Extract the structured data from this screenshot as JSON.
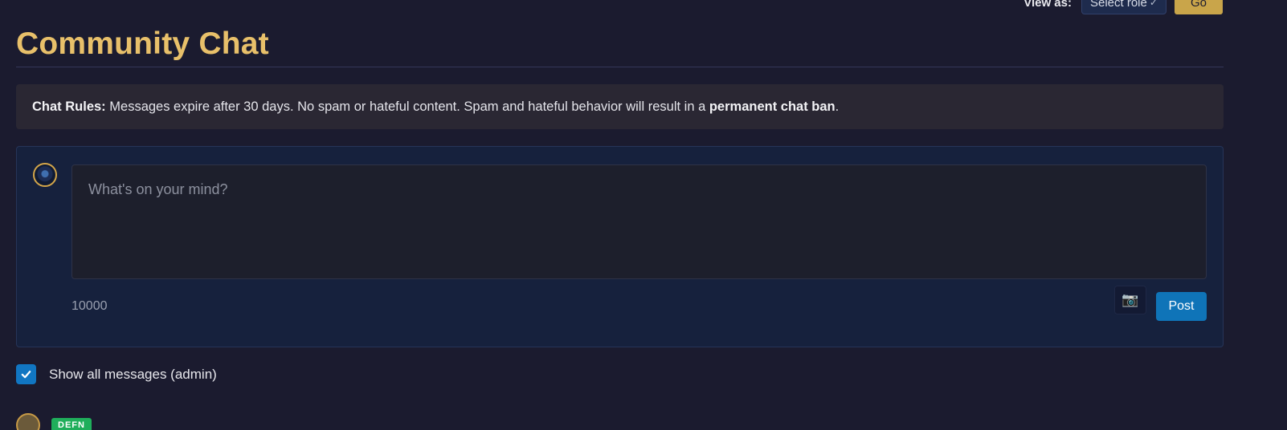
{
  "header": {
    "view_as_label": "View as:",
    "role_select": {
      "value": "Select role",
      "options_visible": [
        "Select role"
      ]
    },
    "go_label": "Go"
  },
  "page": {
    "title": "Community Chat"
  },
  "rules": {
    "heading": "Chat Rules:",
    "text_before": " Messages expire after 30 days. No spam or hateful content. Spam and hateful behavior will result in a ",
    "emphasis": "permanent chat ban",
    "text_after": "."
  },
  "composer": {
    "placeholder": "What's on your mind?",
    "char_count": "10000",
    "camera_icon": "camera-icon",
    "post_label": "Post"
  },
  "filters": {
    "show_all_label": "Show all messages (admin)",
    "show_all_checked": true
  },
  "message_preview": {
    "badge": "DEFN"
  },
  "colors": {
    "background": "#1b1b2f",
    "title": "#e8c06a",
    "accent_button": "#c9a54a",
    "post_button": "#0f74b8",
    "checkbox": "#1176c2",
    "badge": "#1fae5b"
  }
}
